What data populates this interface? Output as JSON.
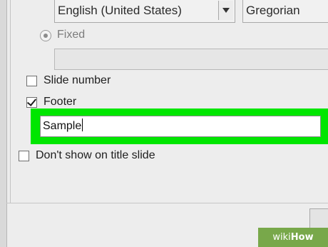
{
  "header_footer_dialog": {
    "language_select": {
      "value": "English (United States)"
    },
    "calendar_select": {
      "value": "Gregorian"
    },
    "fixed_option": {
      "label": "Fixed"
    },
    "slide_number": {
      "label": "Slide number",
      "checked": false
    },
    "footer": {
      "label": "Footer",
      "checked": true,
      "input_value": "Sample"
    },
    "dont_show_on_title_slide": {
      "label": "Don't show on title slide",
      "checked": false
    }
  },
  "watermark": {
    "prefix": "wiki",
    "suffix": "How"
  }
}
